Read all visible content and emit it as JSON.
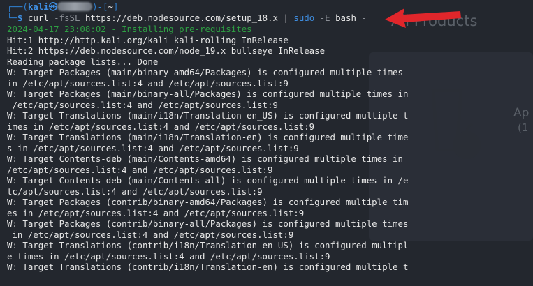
{
  "background": {
    "title": "All Products",
    "side_text_1": "Ap",
    "side_text_2": "(1"
  },
  "prompt": {
    "user": "kali",
    "path": "~",
    "symbol": "$"
  },
  "command": {
    "curl": "curl",
    "curl_flags": "-fsSL",
    "url": "https://deb.nodesource.com/setup_18.x",
    "pipe": "|",
    "sudo": "sudo",
    "sudo_flags": "-E",
    "bash": "bash",
    "bash_flags": "-"
  },
  "output": [
    "2024-04-17 23:08:02 - Installing pre-requisites",
    "Hit:1 http://http.kali.org/kali kali-rolling InRelease",
    "Hit:2 https://deb.nodesource.com/node_19.x bullseye InRelease",
    "Reading package lists... Done",
    "W: Target Packages (main/binary-amd64/Packages) is configured multiple times",
    "in /etc/apt/sources.list:4 and /etc/apt/sources.list:9",
    "W: Target Packages (main/binary-all/Packages) is configured multiple times in",
    " /etc/apt/sources.list:4 and /etc/apt/sources.list:9",
    "W: Target Translations (main/i18n/Translation-en_US) is configured multiple t",
    "imes in /etc/apt/sources.list:4 and /etc/apt/sources.list:9",
    "W: Target Translations (main/i18n/Translation-en) is configured multiple time",
    "s in /etc/apt/sources.list:4 and /etc/apt/sources.list:9",
    "W: Target Contents-deb (main/Contents-amd64) is configured multiple times in",
    "/etc/apt/sources.list:4 and /etc/apt/sources.list:9",
    "W: Target Contents-deb (main/Contents-all) is configured multiple times in /e",
    "tc/apt/sources.list:4 and /etc/apt/sources.list:9",
    "W: Target Packages (contrib/binary-amd64/Packages) is configured multiple tim",
    "es in /etc/apt/sources.list:4 and /etc/apt/sources.list:9",
    "W: Target Packages (contrib/binary-all/Packages) is configured multiple times",
    " in /etc/apt/sources.list:4 and /etc/apt/sources.list:9",
    "W: Target Translations (contrib/i18n/Translation-en_US) is configured multipl",
    "e times in /etc/apt/sources.list:4 and /etc/apt/sources.list:9",
    "W: Target Translations (contrib/i18n/Translation-en) is configured multiple t"
  ],
  "colors": {
    "terminal_bg": "#23272e",
    "prompt_blue": "#3f8fe3",
    "info_green": "#2ea043",
    "arrow_red": "#e0262b"
  }
}
